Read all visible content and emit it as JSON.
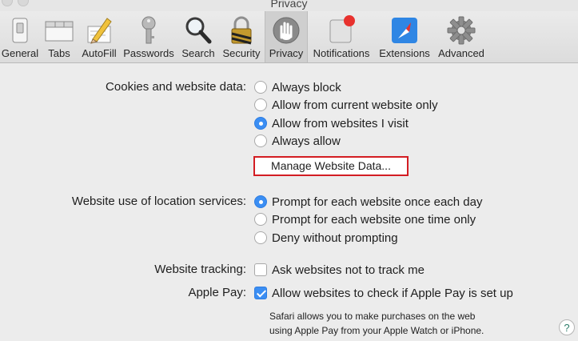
{
  "window": {
    "title": "Privacy"
  },
  "toolbar": {
    "items": [
      {
        "label": "General",
        "icon": "general-switch-icon"
      },
      {
        "label": "Tabs",
        "icon": "tabs-icon"
      },
      {
        "label": "AutoFill",
        "icon": "autofill-pencil-icon"
      },
      {
        "label": "Passwords",
        "icon": "key-icon"
      },
      {
        "label": "Search",
        "icon": "magnifier-icon"
      },
      {
        "label": "Security",
        "icon": "padlock-icon"
      },
      {
        "label": "Privacy",
        "icon": "hand-icon",
        "selected": true
      },
      {
        "label": "Notifications",
        "icon": "notification-badge-icon"
      },
      {
        "label": "Extensions",
        "icon": "extensions-compass-icon"
      },
      {
        "label": "Advanced",
        "icon": "gear-icon"
      }
    ]
  },
  "cookies": {
    "label": "Cookies and website data:",
    "options": [
      "Always block",
      "Allow from current website only",
      "Allow from websites I visit",
      "Always allow"
    ],
    "selected_index": 2,
    "manage_button": "Manage Website Data..."
  },
  "location": {
    "label": "Website use of location services:",
    "options": [
      "Prompt for each website once each day",
      "Prompt for each website one time only",
      "Deny without prompting"
    ],
    "selected_index": 0
  },
  "tracking": {
    "label": "Website tracking:",
    "checkbox_label": "Ask websites not to track me",
    "checked": false
  },
  "apple_pay": {
    "label": "Apple Pay:",
    "checkbox_label": "Allow websites to check if Apple Pay is set up",
    "checked": true,
    "note_line1": "Safari allows you to make purchases on the web",
    "note_line2": "using Apple Pay from your Apple Watch or iPhone."
  },
  "help": {
    "label": "?"
  },
  "colors": {
    "accent": "#3b8ef3",
    "highlight_border": "#d31d23"
  }
}
